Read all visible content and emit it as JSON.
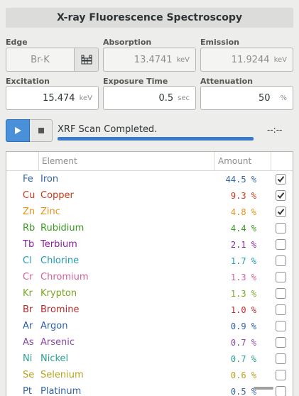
{
  "header": {
    "title": "X-ray Fluorescence Spectroscopy"
  },
  "fields": {
    "edge": {
      "label": "Edge",
      "value": "Br-K"
    },
    "absorption": {
      "label": "Absorption",
      "value": "13.4741",
      "unit": "keV"
    },
    "emission": {
      "label": "Emission",
      "value": "11.9244",
      "unit": "keV"
    },
    "excitation": {
      "label": "Excitation",
      "value": "15.474",
      "unit": "keV"
    },
    "exposure": {
      "label": "Exposure Time",
      "value": "0.5",
      "unit": "sec"
    },
    "attenuation": {
      "label": "Attenuation",
      "value": "50",
      "unit": "%"
    }
  },
  "scan": {
    "status": "XRF Scan Completed.",
    "time": "--:--",
    "progress": 1.0
  },
  "table": {
    "columns": {
      "element": "Element",
      "amount": "Amount"
    },
    "rows": [
      {
        "symbol": "Fe",
        "name": "Iron",
        "amount": "44.5 %",
        "checked": true,
        "color": "#3465a4"
      },
      {
        "symbol": "Cu",
        "name": "Copper",
        "amount": "9.3 %",
        "checked": true,
        "color": "#cc3a1c"
      },
      {
        "symbol": "Zn",
        "name": "Zinc",
        "amount": "4.8 %",
        "checked": true,
        "color": "#e5941a"
      },
      {
        "symbol": "Rb",
        "name": "Rubidium",
        "amount": "4.4 %",
        "checked": false,
        "color": "#3a9a1e"
      },
      {
        "symbol": "Tb",
        "name": "Terbium",
        "amount": "2.1 %",
        "checked": false,
        "color": "#8a1ea0"
      },
      {
        "symbol": "Cl",
        "name": "Chlorine",
        "amount": "1.7 %",
        "checked": false,
        "color": "#1f9bb5"
      },
      {
        "symbol": "Cr",
        "name": "Chromium",
        "amount": "1.3 %",
        "checked": false,
        "color": "#d65f98"
      },
      {
        "symbol": "Kr",
        "name": "Krypton",
        "amount": "1.3 %",
        "checked": false,
        "color": "#78a81e"
      },
      {
        "symbol": "Br",
        "name": "Bromine",
        "amount": "1.0 %",
        "checked": false,
        "color": "#b52a2a"
      },
      {
        "symbol": "Ar",
        "name": "Argon",
        "amount": "0.9 %",
        "checked": false,
        "color": "#2f5fa8"
      },
      {
        "symbol": "As",
        "name": "Arsenic",
        "amount": "0.7 %",
        "checked": false,
        "color": "#8a4aa8"
      },
      {
        "symbol": "Ni",
        "name": "Nickel",
        "amount": "0.7 %",
        "checked": false,
        "color": "#2aa08f"
      },
      {
        "symbol": "Se",
        "name": "Selenium",
        "amount": "0.6 %",
        "checked": false,
        "color": "#b5a21e"
      },
      {
        "symbol": "Pt",
        "name": "Platinum",
        "amount": "0.5 %",
        "checked": false,
        "color": "#3465a4"
      }
    ]
  },
  "icons": {
    "edge_button": "periodic-table-icon",
    "play": "play-icon",
    "stop": "stop-icon",
    "check": "checkmark-icon"
  }
}
